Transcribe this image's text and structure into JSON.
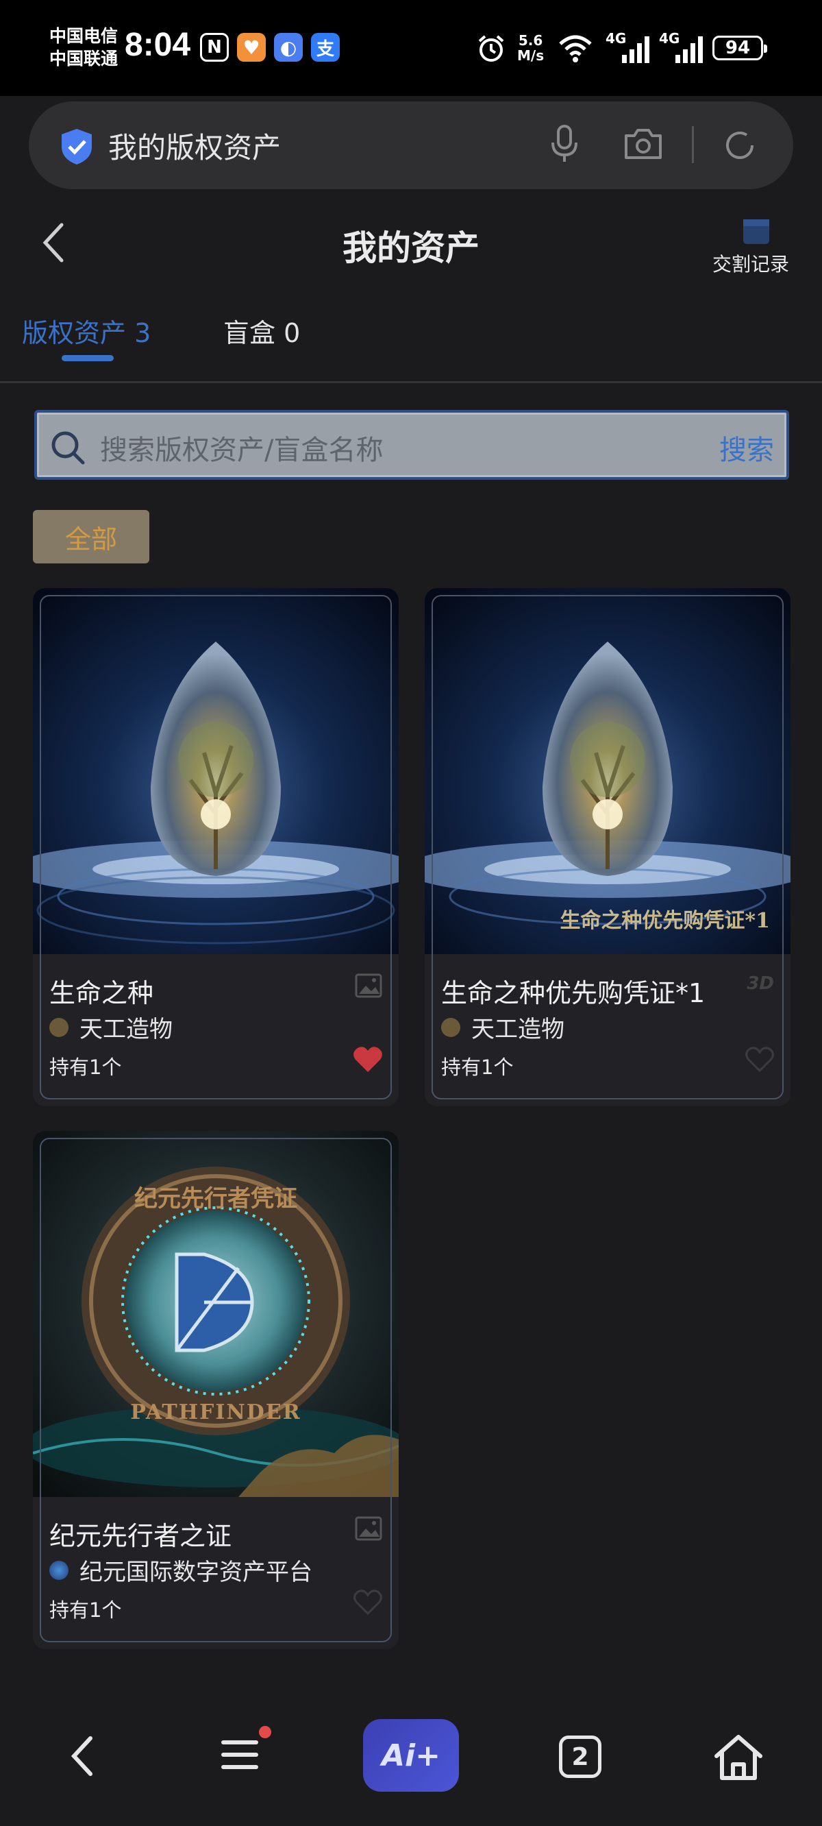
{
  "status_bar": {
    "carrier_1": "中国电信",
    "carrier_2": "中国联通",
    "time": "8:04",
    "net_speed_value": "5.6",
    "net_speed_unit": "M/s",
    "signal_1": "4G",
    "signal_2": "4G",
    "battery": "94"
  },
  "browser": {
    "url_text": "我的版权资产"
  },
  "header": {
    "title": "我的资产",
    "records_label": "交割记录"
  },
  "tabs": [
    {
      "label": "版权资产 3",
      "active": true
    },
    {
      "label": "盲盒 0",
      "active": false
    }
  ],
  "search": {
    "placeholder": "搜索版权资产/盲盒名称",
    "button_label": "搜索"
  },
  "filter": {
    "selected": "全部"
  },
  "assets": [
    {
      "name": "生命之种",
      "creator": "天工造物",
      "hold": "持有1个",
      "type_icon": "image-icon",
      "liked": true,
      "art_caption": ""
    },
    {
      "name": "生命之种优先购凭证*1",
      "creator": "天工造物",
      "hold": "持有1个",
      "type_icon": "3d-icon",
      "type_text": "3D",
      "liked": false,
      "art_caption": "生命之种优先购凭证*1"
    },
    {
      "name": "纪元先行者之证",
      "creator": "纪元国际数字资产平台",
      "hold": "持有1个",
      "type_icon": "image-icon",
      "liked": false,
      "art_caption": "",
      "coin_top_text": "纪元先行者凭证",
      "coin_bottom_text": "PATHFINDER"
    }
  ],
  "bottom_nav": {
    "ai_label": "Ai+",
    "tab_count": "2"
  },
  "colors": {
    "accent_blue": "#3b72c9",
    "chip_text": "#d29a42",
    "like_red": "#c9393f",
    "background": "#1b1b1d"
  }
}
